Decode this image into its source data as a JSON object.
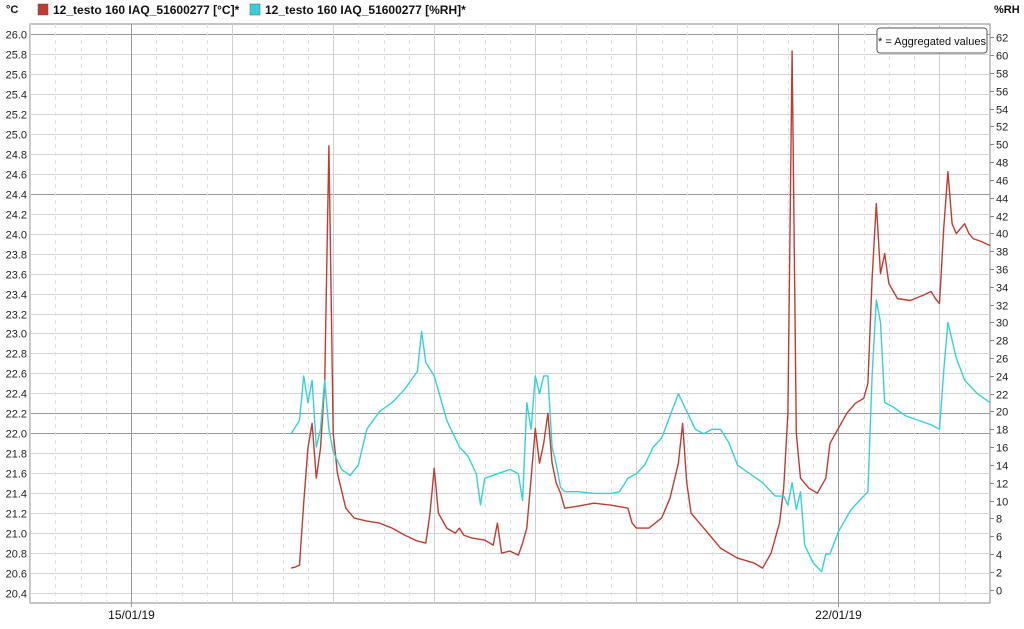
{
  "chart_data": {
    "type": "line",
    "title": "",
    "y_left": {
      "unit": "°C",
      "range": [
        20.3,
        26.1
      ],
      "ticks": [
        20.4,
        20.6,
        20.8,
        21.0,
        21.2,
        21.4,
        21.6,
        21.8,
        22.0,
        22.2,
        22.4,
        22.6,
        22.8,
        23.0,
        23.2,
        23.4,
        23.6,
        23.8,
        24.0,
        24.2,
        24.4,
        24.6,
        24.8,
        25.0,
        25.2,
        25.4,
        25.6,
        25.8,
        26.0
      ]
    },
    "y_right": {
      "unit": "%RH",
      "range": [
        -1.5,
        63.5
      ],
      "ticks": [
        0,
        2,
        4,
        6,
        8,
        10,
        12,
        14,
        16,
        18,
        20,
        22,
        24,
        26,
        28,
        30,
        32,
        34,
        36,
        38,
        40,
        42,
        44,
        46,
        48,
        50,
        52,
        54,
        56,
        58,
        60,
        62
      ]
    },
    "x": {
      "type": "date",
      "range": [
        "14/01/19 00:00",
        "23/01/19 12:00"
      ],
      "major_ticks": [
        {
          "x": "15/01/19",
          "label": "15/01/19"
        },
        {
          "x": "22/01/19",
          "label": "22/01/19"
        }
      ]
    },
    "grid": true,
    "legend_position": "top",
    "note": "* = Aggregated values",
    "series": [
      {
        "name": "12_testo 160 IAQ_51600277 [°C]*",
        "axis": "left",
        "color": "#c23b32",
        "points": [
          [
            "16/01/19 14:00",
            20.65
          ],
          [
            "16/01/19 15:00",
            20.66
          ],
          [
            "16/01/19 16:00",
            20.68
          ],
          [
            "16/01/19 17:00",
            21.3
          ],
          [
            "16/01/19 18:00",
            21.85
          ],
          [
            "16/01/19 19:00",
            22.1
          ],
          [
            "16/01/19 20:00",
            21.55
          ],
          [
            "16/01/19 21:00",
            21.85
          ],
          [
            "16/01/19 22:00",
            22.5
          ],
          [
            "16/01/19 23:00",
            24.88
          ],
          [
            "17/01/19 00:00",
            22.0
          ],
          [
            "17/01/19 01:00",
            21.6
          ],
          [
            "17/01/19 03:00",
            21.25
          ],
          [
            "17/01/19 05:00",
            21.15
          ],
          [
            "17/01/19 08:00",
            21.12
          ],
          [
            "17/01/19 11:00",
            21.1
          ],
          [
            "17/01/19 14:00",
            21.05
          ],
          [
            "17/01/19 17:00",
            20.98
          ],
          [
            "17/01/19 20:00",
            20.92
          ],
          [
            "17/01/19 22:00",
            20.9
          ],
          [
            "17/01/19 23:00",
            21.2
          ],
          [
            "18/01/19 00:00",
            21.65
          ],
          [
            "18/01/19 01:00",
            21.2
          ],
          [
            "18/01/19 03:00",
            21.05
          ],
          [
            "18/01/19 05:00",
            21.0
          ],
          [
            "18/01/19 06:00",
            21.05
          ],
          [
            "18/01/19 07:00",
            20.98
          ],
          [
            "18/01/19 09:00",
            20.95
          ],
          [
            "18/01/19 12:00",
            20.93
          ],
          [
            "18/01/19 14:00",
            20.88
          ],
          [
            "18/01/19 15:00",
            21.1
          ],
          [
            "18/01/19 16:00",
            20.8
          ],
          [
            "18/01/19 18:00",
            20.82
          ],
          [
            "18/01/19 20:00",
            20.78
          ],
          [
            "18/01/19 21:00",
            20.9
          ],
          [
            "18/01/19 22:00",
            21.05
          ],
          [
            "18/01/19 23:00",
            21.55
          ],
          [
            "19/01/19 00:00",
            22.05
          ],
          [
            "19/01/19 01:00",
            21.7
          ],
          [
            "19/01/19 02:00",
            21.9
          ],
          [
            "19/01/19 03:00",
            22.2
          ],
          [
            "19/01/19 04:00",
            21.7
          ],
          [
            "19/01/19 05:00",
            21.5
          ],
          [
            "19/01/19 06:00",
            21.4
          ],
          [
            "19/01/19 07:00",
            21.25
          ],
          [
            "19/01/19 10:00",
            21.27
          ],
          [
            "19/01/19 14:00",
            21.3
          ],
          [
            "19/01/19 18:00",
            21.28
          ],
          [
            "19/01/19 22:00",
            21.25
          ],
          [
            "19/01/19 23:00",
            21.1
          ],
          [
            "20/01/19 00:00",
            21.05
          ],
          [
            "20/01/19 03:00",
            21.05
          ],
          [
            "20/01/19 06:00",
            21.15
          ],
          [
            "20/01/19 08:00",
            21.35
          ],
          [
            "20/01/19 10:00",
            21.7
          ],
          [
            "20/01/19 11:00",
            22.1
          ],
          [
            "20/01/19 12:00",
            21.5
          ],
          [
            "20/01/19 13:00",
            21.2
          ],
          [
            "20/01/19 16:00",
            21.05
          ],
          [
            "20/01/19 20:00",
            20.85
          ],
          [
            "21/01/19 00:00",
            20.75
          ],
          [
            "21/01/19 04:00",
            20.7
          ],
          [
            "21/01/19 06:00",
            20.65
          ],
          [
            "21/01/19 08:00",
            20.8
          ],
          [
            "21/01/19 10:00",
            21.1
          ],
          [
            "21/01/19 11:00",
            21.45
          ],
          [
            "21/01/19 12:00",
            22.2
          ],
          [
            "21/01/19 13:00",
            25.83
          ],
          [
            "21/01/19 14:00",
            22.0
          ],
          [
            "21/01/19 15:00",
            21.55
          ],
          [
            "21/01/19 17:00",
            21.45
          ],
          [
            "21/01/19 19:00",
            21.4
          ],
          [
            "21/01/19 21:00",
            21.55
          ],
          [
            "21/01/19 22:00",
            21.9
          ],
          [
            "22/01/19 00:00",
            22.05
          ],
          [
            "22/01/19 02:00",
            22.2
          ],
          [
            "22/01/19 04:00",
            22.3
          ],
          [
            "22/01/19 06:00",
            22.35
          ],
          [
            "22/01/19 07:00",
            22.5
          ],
          [
            "22/01/19 08:00",
            23.55
          ],
          [
            "22/01/19 09:00",
            24.3
          ],
          [
            "22/01/19 10:00",
            23.6
          ],
          [
            "22/01/19 11:00",
            23.8
          ],
          [
            "22/01/19 12:00",
            23.5
          ],
          [
            "22/01/19 14:00",
            23.35
          ],
          [
            "22/01/19 17:00",
            23.33
          ],
          [
            "22/01/19 20:00",
            23.38
          ],
          [
            "22/01/19 22:00",
            23.42
          ],
          [
            "22/01/19 23:00",
            23.35
          ],
          [
            "23/01/19 00:00",
            23.3
          ],
          [
            "23/01/19 01:00",
            24.05
          ],
          [
            "23/01/19 02:00",
            24.62
          ],
          [
            "23/01/19 03:00",
            24.1
          ],
          [
            "23/01/19 04:00",
            24.0
          ],
          [
            "23/01/19 05:00",
            24.05
          ],
          [
            "23/01/19 06:00",
            24.1
          ],
          [
            "23/01/19 07:00",
            24.0
          ],
          [
            "23/01/19 08:00",
            23.95
          ],
          [
            "23/01/19 10:00",
            23.92
          ],
          [
            "23/01/19 11:00",
            23.9
          ],
          [
            "23/01/19 12:00",
            23.88
          ]
        ]
      },
      {
        "name": "12_testo 160 IAQ_51600277 [%RH]*",
        "axis": "right",
        "color": "#35d1d8",
        "points": [
          [
            "16/01/19 14:00",
            17.5
          ],
          [
            "16/01/19 16:00",
            19.0
          ],
          [
            "16/01/19 17:00",
            24.0
          ],
          [
            "16/01/19 18:00",
            21.0
          ],
          [
            "16/01/19 19:00",
            23.5
          ],
          [
            "16/01/19 20:00",
            16.0
          ],
          [
            "16/01/19 21:00",
            18.0
          ],
          [
            "16/01/19 22:00",
            23.5
          ],
          [
            "16/01/19 23:00",
            18.0
          ],
          [
            "17/01/19 00:00",
            15.5
          ],
          [
            "17/01/19 02:00",
            13.5
          ],
          [
            "17/01/19 04:00",
            12.8
          ],
          [
            "17/01/19 06:00",
            14.0
          ],
          [
            "17/01/19 08:00",
            18.0
          ],
          [
            "17/01/19 11:00",
            20.0
          ],
          [
            "17/01/19 14:00",
            21.0
          ],
          [
            "17/01/19 17:00",
            22.5
          ],
          [
            "17/01/19 20:00",
            24.5
          ],
          [
            "17/01/19 21:00",
            29.0
          ],
          [
            "17/01/19 22:00",
            25.5
          ],
          [
            "18/01/19 00:00",
            24.0
          ],
          [
            "18/01/19 03:00",
            19.0
          ],
          [
            "18/01/19 06:00",
            16.0
          ],
          [
            "18/01/19 08:00",
            15.0
          ],
          [
            "18/01/19 10:00",
            13.0
          ],
          [
            "18/01/19 11:00",
            9.5
          ],
          [
            "18/01/19 12:00",
            12.5
          ],
          [
            "18/01/19 15:00",
            13.0
          ],
          [
            "18/01/19 18:00",
            13.5
          ],
          [
            "18/01/19 20:00",
            13.0
          ],
          [
            "18/01/19 21:00",
            10.0
          ],
          [
            "18/01/19 22:00",
            21.0
          ],
          [
            "18/01/19 23:00",
            18.0
          ],
          [
            "19/01/19 00:00",
            24.0
          ],
          [
            "19/01/19 01:00",
            22.0
          ],
          [
            "19/01/19 02:00",
            24.0
          ],
          [
            "19/01/19 03:00",
            24.0
          ],
          [
            "19/01/19 04:00",
            16.0
          ],
          [
            "19/01/19 05:00",
            14.0
          ],
          [
            "19/01/19 06:00",
            11.5
          ],
          [
            "19/01/19 07:00",
            11.0
          ],
          [
            "19/01/19 10:00",
            11.0
          ],
          [
            "19/01/19 14:00",
            10.8
          ],
          [
            "19/01/19 18:00",
            10.8
          ],
          [
            "19/01/19 20:00",
            11.0
          ],
          [
            "19/01/19 22:00",
            12.5
          ],
          [
            "20/01/19 00:00",
            13.0
          ],
          [
            "20/01/19 02:00",
            14.0
          ],
          [
            "20/01/19 04:00",
            16.0
          ],
          [
            "20/01/19 06:00",
            17.0
          ],
          [
            "20/01/19 08:00",
            19.5
          ],
          [
            "20/01/19 10:00",
            22.0
          ],
          [
            "20/01/19 12:00",
            20.0
          ],
          [
            "20/01/19 14:00",
            18.0
          ],
          [
            "20/01/19 16:00",
            17.5
          ],
          [
            "20/01/19 18:00",
            18.0
          ],
          [
            "20/01/19 20:00",
            18.0
          ],
          [
            "20/01/19 22:00",
            16.5
          ],
          [
            "21/01/19 00:00",
            14.0
          ],
          [
            "21/01/19 03:00",
            13.0
          ],
          [
            "21/01/19 06:00",
            12.0
          ],
          [
            "21/01/19 09:00",
            10.5
          ],
          [
            "21/01/19 11:00",
            10.5
          ],
          [
            "21/01/19 12:00",
            9.5
          ],
          [
            "21/01/19 13:00",
            12.0
          ],
          [
            "21/01/19 14:00",
            9.0
          ],
          [
            "21/01/19 15:00",
            11.0
          ],
          [
            "21/01/19 16:00",
            5.0
          ],
          [
            "21/01/19 17:00",
            4.0
          ],
          [
            "21/01/19 18:00",
            3.0
          ],
          [
            "21/01/19 19:00",
            2.5
          ],
          [
            "21/01/19 20:00",
            2.0
          ],
          [
            "21/01/19 21:00",
            4.0
          ],
          [
            "21/01/19 22:00",
            4.0
          ],
          [
            "22/01/19 00:00",
            6.5
          ],
          [
            "22/01/19 03:00",
            9.0
          ],
          [
            "22/01/19 06:00",
            10.5
          ],
          [
            "22/01/19 07:00",
            11.0
          ],
          [
            "22/01/19 08:00",
            24.0
          ],
          [
            "22/01/19 09:00",
            32.5
          ],
          [
            "22/01/19 10:00",
            30.0
          ],
          [
            "22/01/19 11:00",
            21.0
          ],
          [
            "22/01/19 13:00",
            20.5
          ],
          [
            "22/01/19 16:00",
            19.5
          ],
          [
            "22/01/19 19:00",
            19.0
          ],
          [
            "22/01/19 22:00",
            18.5
          ],
          [
            "23/01/19 00:00",
            18.0
          ],
          [
            "23/01/19 01:00",
            24.5
          ],
          [
            "23/01/19 02:00",
            30.0
          ],
          [
            "23/01/19 04:00",
            26.0
          ],
          [
            "23/01/19 06:00",
            23.5
          ],
          [
            "23/01/19 09:00",
            22.0
          ],
          [
            "23/01/19 12:00",
            21.0
          ]
        ]
      }
    ]
  }
}
